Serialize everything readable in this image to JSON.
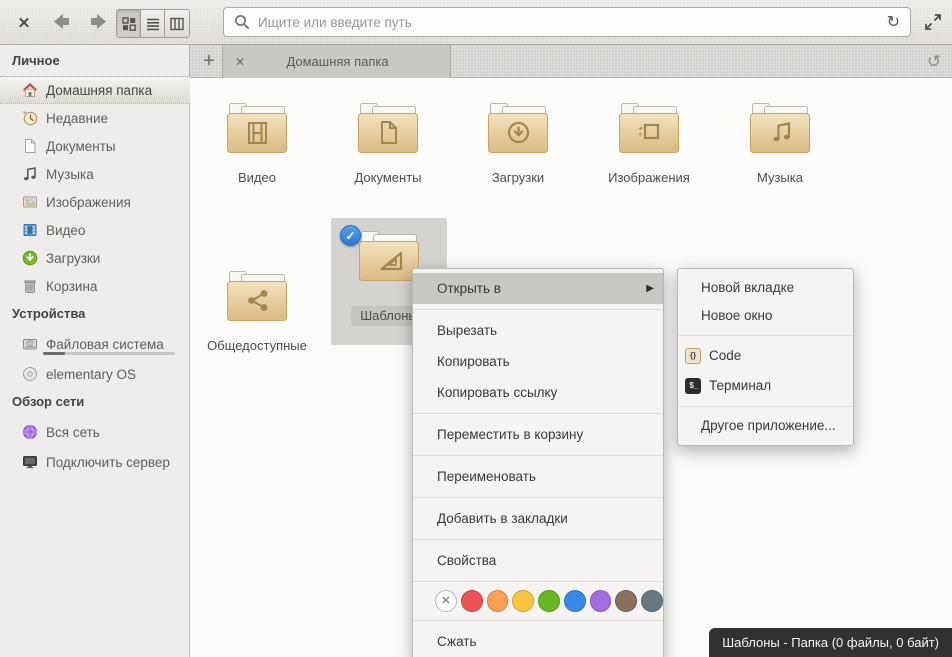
{
  "icons": {
    "window_close": "✕",
    "tab_close": "✕",
    "new_tab": "+",
    "refresh": "↻",
    "history": "↺",
    "submenu_arrow": "▶",
    "selected_check": "✓",
    "clear_color": "✕"
  },
  "toolbar": {
    "search_placeholder": "Ищите или введите путь"
  },
  "tabbar": {
    "tab_label": "Домашняя папка"
  },
  "sidebar": {
    "sections": [
      {
        "header": "Личное",
        "items": [
          {
            "label": "Домашняя папка"
          },
          {
            "label": "Недавние"
          },
          {
            "label": "Документы"
          },
          {
            "label": "Музыка"
          },
          {
            "label": "Изображения"
          },
          {
            "label": "Видео"
          },
          {
            "label": "Загрузки"
          },
          {
            "label": "Корзина"
          }
        ]
      },
      {
        "header": "Устройства",
        "items": [
          {
            "label": "Файловая система"
          },
          {
            "label": "elementary OS"
          }
        ]
      },
      {
        "header": "Обзор сети",
        "items": [
          {
            "label": "Вся сеть"
          },
          {
            "label": "Подключить сервер"
          }
        ]
      }
    ]
  },
  "files": {
    "items": [
      {
        "label": "Видео"
      },
      {
        "label": "Документы"
      },
      {
        "label": "Загрузки"
      },
      {
        "label": "Изображения"
      },
      {
        "label": "Музыка"
      },
      {
        "label": "Общедоступные"
      },
      {
        "label": "Шаблоны"
      }
    ]
  },
  "context_menu": {
    "open_with": "Открыть в",
    "cut": "Вырезать",
    "copy": "Копировать",
    "copy_link": "Копировать ссылку",
    "move_to_trash": "Переместить в корзину",
    "rename": "Переименовать",
    "add_bookmark": "Добавить в закладки",
    "properties": "Свойства",
    "compress": "Сжать",
    "color_tags": [
      "#ffffff",
      "#ed5353",
      "#ffa154",
      "#f9c440",
      "#68b723",
      "#3689e6",
      "#a56de2",
      "#8a715e",
      "#667885"
    ]
  },
  "submenu": {
    "new_tab": "Новой вкладке",
    "new_window": "Новое окно",
    "code": "Code",
    "terminal": "Терминал",
    "other_app": "Другое приложение..."
  },
  "statusbar": {
    "text": "Шаблоны - Папка (0 файлы, 0 байт)"
  },
  "colors": {
    "accent_blue": "#3689e6",
    "folder_tan": "#dcba82",
    "selection_gray": "#d5d3d0"
  }
}
